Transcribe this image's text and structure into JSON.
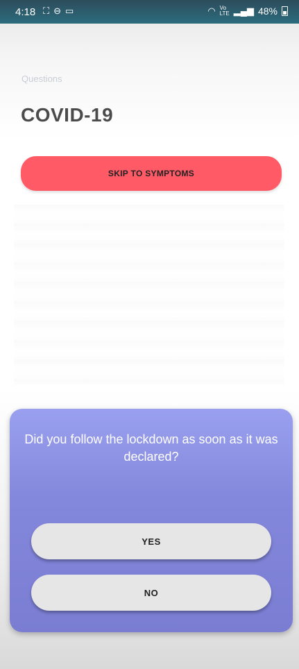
{
  "status_bar": {
    "time": "4:18",
    "battery": "48%",
    "left_icons": [
      "screenshot-icon",
      "dnd-icon",
      "laptop-icon"
    ],
    "right_icons": [
      "wifi-icon",
      "volte-icon",
      "signal-icon",
      "battery-icon"
    ],
    "volte_text": "Vo))\nLTE"
  },
  "header": {
    "section_label": "Questions",
    "title": "COVID-19"
  },
  "skip_button": {
    "label": "SKIP TO SYMPTOMS",
    "color": "#ff5a66"
  },
  "question_card": {
    "text": "Did you follow the lockdown as soon as it was declared?",
    "background": "#8a8ee3",
    "answers": [
      {
        "label": "YES"
      },
      {
        "label": "NO"
      }
    ]
  }
}
